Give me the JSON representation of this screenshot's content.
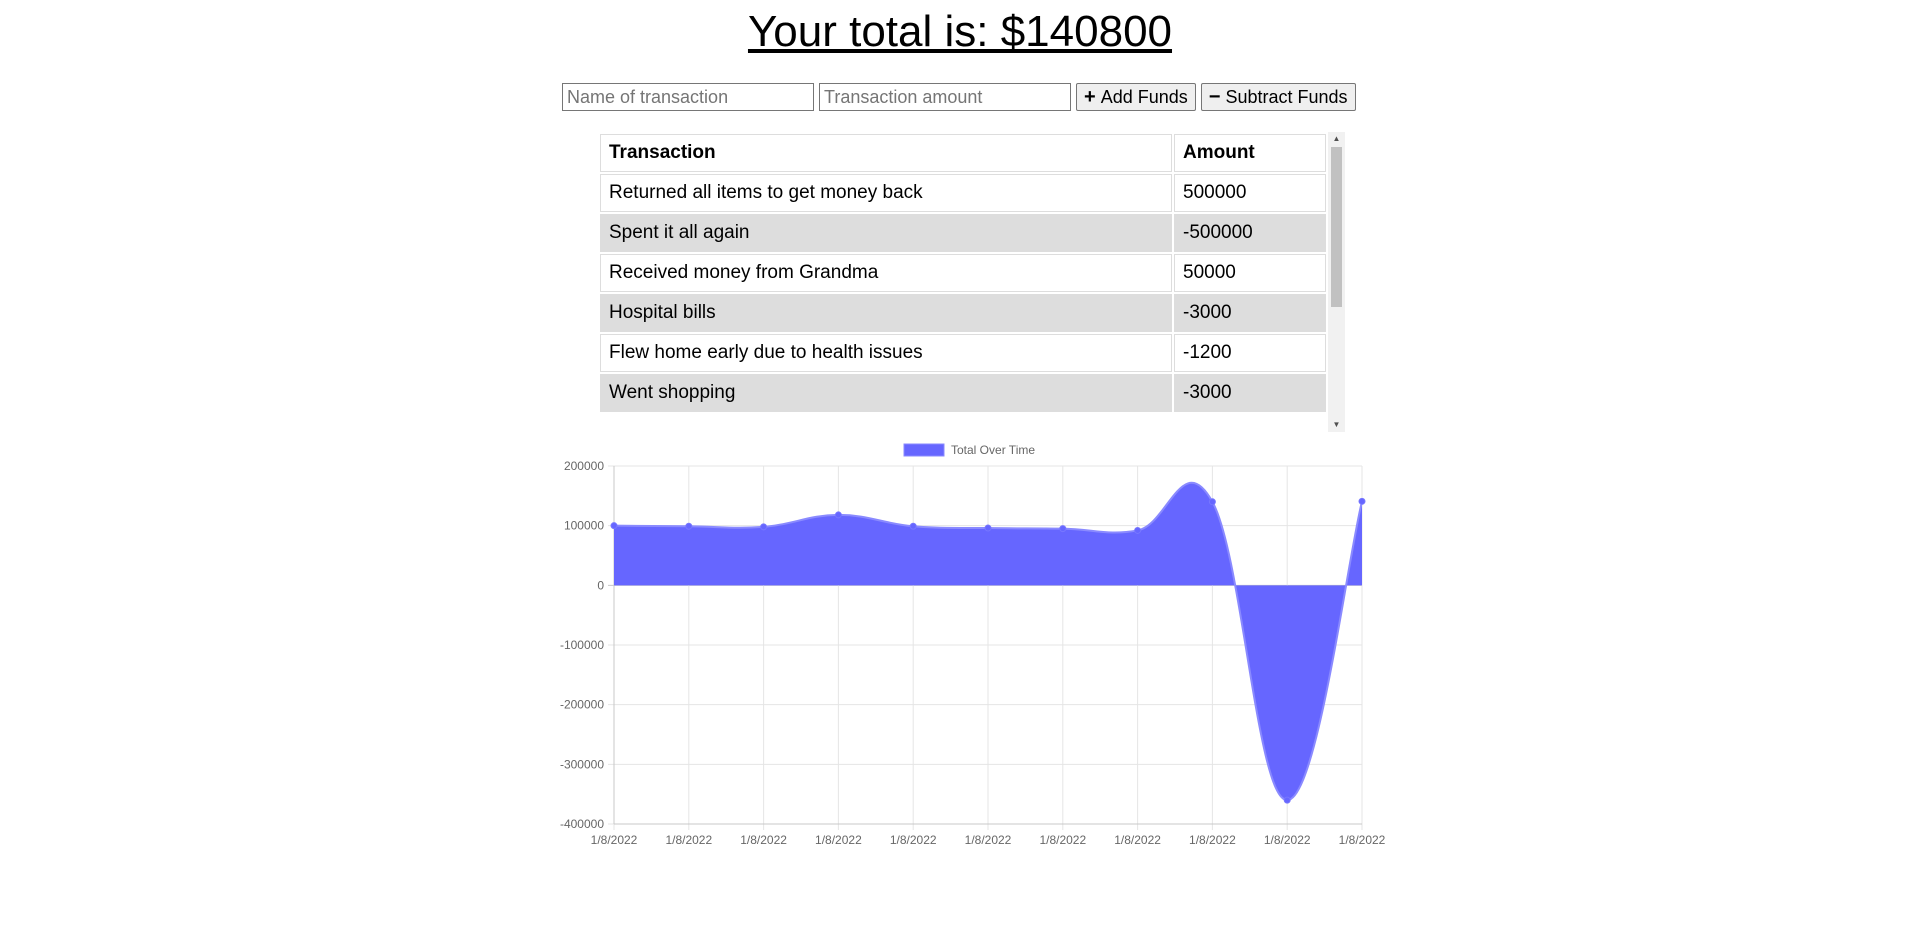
{
  "header": {
    "total_text": "Your total is: $140800"
  },
  "form": {
    "name_placeholder": "Name of transaction",
    "amount_placeholder": "Transaction amount",
    "add_label": "Add Funds",
    "subtract_label": "Subtract Funds",
    "add_icon": "plus-icon",
    "subtract_icon": "minus-icon"
  },
  "table": {
    "headers": [
      "Transaction",
      "Amount"
    ],
    "rows": [
      {
        "name": "Returned all items to get money back",
        "amount": "500000"
      },
      {
        "name": "Spent it all again",
        "amount": "-500000"
      },
      {
        "name": "Received money from Grandma",
        "amount": "50000"
      },
      {
        "name": "Hospital bills",
        "amount": "-3000"
      },
      {
        "name": "Flew home early due to health issues",
        "amount": "-1200"
      },
      {
        "name": "Went shopping",
        "amount": "-3000"
      }
    ]
  },
  "chart_data": {
    "type": "area",
    "legend": "Total Over Time",
    "legend_position": "top-center",
    "color": "#6666ff",
    "grid": true,
    "x": [
      "1/8/2022",
      "1/8/2022",
      "1/8/2022",
      "1/8/2022",
      "1/8/2022",
      "1/8/2022",
      "1/8/2022",
      "1/8/2022",
      "1/8/2022",
      "1/8/2022",
      "1/8/2022"
    ],
    "values": [
      100000,
      99000,
      98000,
      118000,
      99000,
      96000,
      95000,
      92000,
      140000,
      -360000,
      140800
    ],
    "ylim": [
      -400000,
      200000
    ],
    "yticks": [
      200000,
      100000,
      0,
      -100000,
      -200000,
      -300000,
      -400000
    ]
  }
}
